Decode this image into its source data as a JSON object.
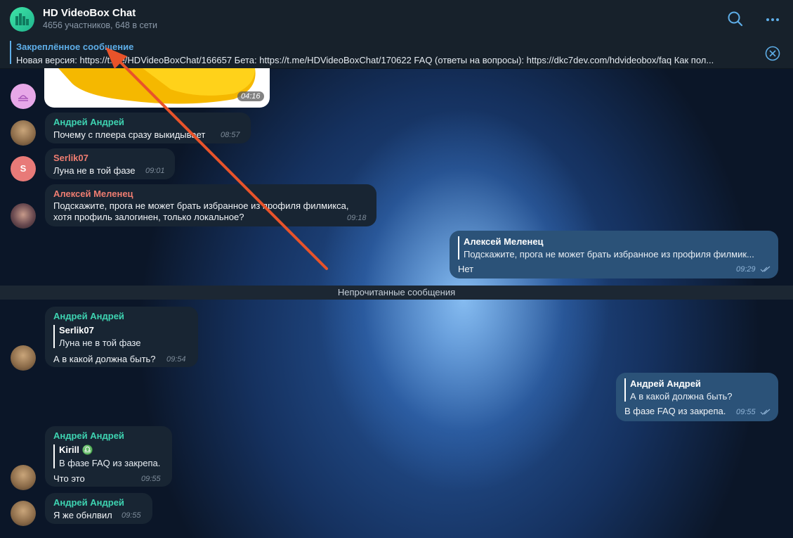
{
  "header": {
    "title": "HD VideoBox Chat",
    "subtitle": "4656 участников, 648 в сети",
    "search_icon": "search-icon",
    "more_icon": "more-icon"
  },
  "pinned": {
    "title": "Закреплённое сообщение",
    "text": "Новая версия: https://t.me/HDVideoBoxChat/166657  Бета: https://t.me/HDVideoBoxChat/170622  FAQ (ответы на вопросы): https://dkc7dev.com/hdvideobox/faq  Как пол..."
  },
  "messages": [
    {
      "time": "04:16"
    },
    {
      "name": "Андрей Андрей",
      "text": "Почему с плеера сразу выкидывает",
      "time": "08:57"
    },
    {
      "name": "Serlik07",
      "avatar_letter": "S",
      "text": "Луна не в той фазе",
      "time": "09:01"
    },
    {
      "name": "Алексей Меленец",
      "text_line1": "Подскажите, прога не может брать избранное из профиля филмикса,",
      "text_line2": "хотя профиль залогинен, только локальное?",
      "time": "09:18"
    },
    {
      "quote_name": "Алексей Меленец",
      "quote_text": "Подскажите, прога не может брать избранное из профиля филмик...",
      "text": "Нет",
      "time": "09:29"
    },
    {
      "name": "Андрей Андрей",
      "quote_name": "Serlik07",
      "quote_text": "Луна не в той фазе",
      "text": "А в какой должна быть?",
      "time": "09:54"
    },
    {
      "quote_name": "Андрей Андрей",
      "quote_text": "А в какой должна быть?",
      "text": "В фазе FAQ из закрепа.",
      "time": "09:55"
    },
    {
      "name": "Андрей Андрей",
      "quote_name": "Kirill ♎",
      "quote_text": "В фазе FAQ из закрепа.",
      "text": "Что это",
      "time": "09:55"
    },
    {
      "name": "Андрей Андрей",
      "text": "Я же обнлвил",
      "time": "09:55"
    }
  ],
  "unread_divider": "Непрочитанные сообщения",
  "colors": {
    "accent": "#5eaee8",
    "name_teal": "#3ed3b1",
    "name_salmon": "#ef7d71",
    "incoming_bubble": "#182533",
    "outgoing_bubble": "#2b5278",
    "annotation_arrow": "#e8532a"
  }
}
